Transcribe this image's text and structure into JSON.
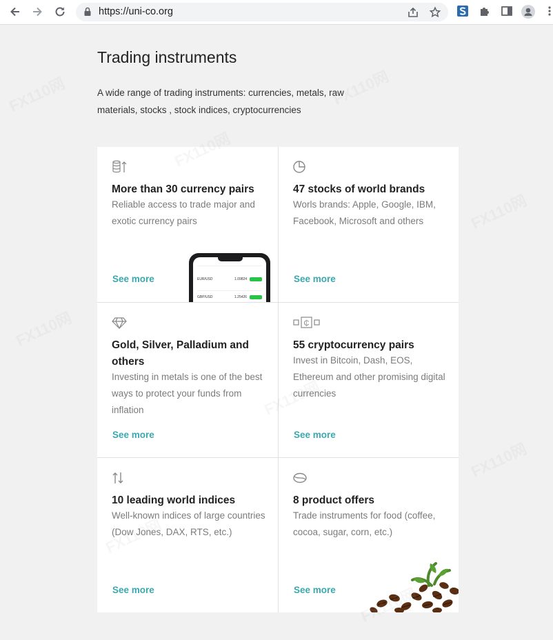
{
  "browser": {
    "url": "https://uni-co.org"
  },
  "page": {
    "title": "Trading instruments",
    "lead": "A wide range of trading instruments: currencies, metals, raw materials, stocks , stock indices, cryptocurrencies"
  },
  "cards": [
    {
      "icon": "coins-stack-icon",
      "title": "More than 30 currency pairs",
      "desc": "Reliable access to trade major and exotic currency pairs",
      "link": "See more"
    },
    {
      "icon": "pie-chart-icon",
      "title": "47 stocks of world brands",
      "desc": "Worls brands: Apple, Google, IBM, Facebook, Microsoft and others",
      "link": "See more"
    },
    {
      "icon": "diamond-icon",
      "title": "Gold, Silver, Palladium and others",
      "desc": "Investing in metals is one of the best ways to protect your funds from inflation",
      "link": "See more"
    },
    {
      "icon": "crypto-coin-icon",
      "title": "55 cryptocurrency pairs",
      "desc": "Invest in Bitcoin, Dash, EOS, Ethereum and other promising digital currencies",
      "link": "See more"
    },
    {
      "icon": "up-down-arrows-icon",
      "title": "10 leading world indices",
      "desc": "Well-known indices of large countries (Dow Jones, DAX, RTS, etc.)",
      "link": "See more"
    },
    {
      "icon": "bean-icon",
      "title": "8 product offers",
      "desc": "Trade instruments for food (coffee, cocoa, sugar, corn, etc.)",
      "link": "See more"
    }
  ],
  "phone": {
    "rows": [
      {
        "pair": "EUR/USD",
        "price": "1.09824"
      },
      {
        "pair": "GBP/USD",
        "price": "1.25426"
      }
    ]
  },
  "watermark": "FX110网"
}
